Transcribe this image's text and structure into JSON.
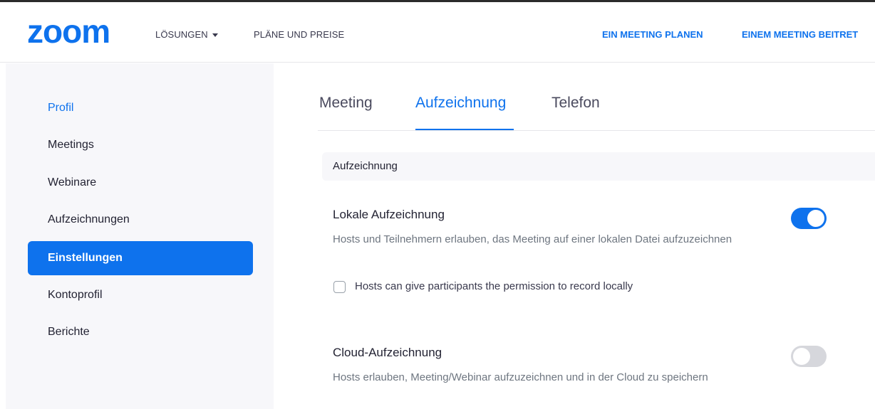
{
  "brand": {
    "logo_text": "zoom",
    "accent_color": "#0e72ed"
  },
  "topnav": {
    "solutions": "LÖSUNGEN",
    "plans": "PLÄNE UND PREISE",
    "schedule": "EIN MEETING PLANEN",
    "join": "EINEM MEETING BEITRET"
  },
  "sidebar": {
    "items": [
      {
        "label": "Profil",
        "state": "link"
      },
      {
        "label": "Meetings",
        "state": "normal"
      },
      {
        "label": "Webinare",
        "state": "normal"
      },
      {
        "label": "Aufzeichnungen",
        "state": "normal"
      },
      {
        "label": "Einstellungen",
        "state": "active"
      },
      {
        "label": "Kontoprofil",
        "state": "normal"
      },
      {
        "label": "Berichte",
        "state": "normal"
      }
    ]
  },
  "tabs": {
    "items": [
      "Meeting",
      "Aufzeichnung",
      "Telefon"
    ],
    "active": "Aufzeichnung"
  },
  "section": {
    "title": "Aufzeichnung"
  },
  "settings": {
    "local": {
      "title": "Lokale Aufzeichnung",
      "description": "Hosts und Teilnehmern erlauben, das Meeting auf einer lokalen Datei aufzuzeichnen",
      "enabled": true,
      "option_label": "Hosts can give participants the permission to record locally",
      "option_checked": false
    },
    "cloud": {
      "title": "Cloud-Aufzeichnung",
      "description": "Hosts erlauben, Meeting/Webinar aufzuzeichnen und in der Cloud zu speichern",
      "enabled": false
    }
  }
}
